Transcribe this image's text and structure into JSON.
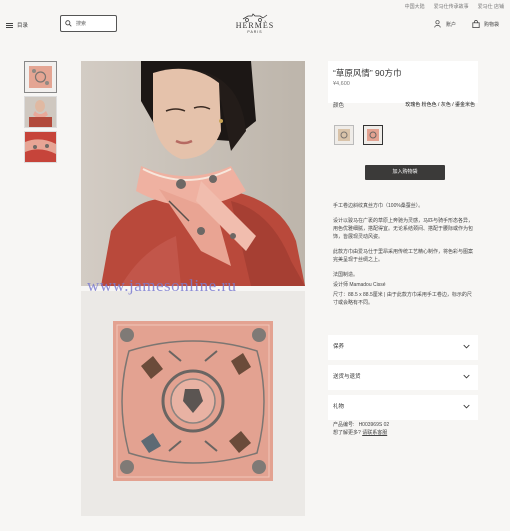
{
  "util_links": [
    "中国大陆",
    "爱马仕传承故事",
    "爱马仕 店铺"
  ],
  "menu_label": "目录",
  "search": {
    "placeholder": "搜索"
  },
  "brand": {
    "name": "HERMÈS",
    "city": "PARIS"
  },
  "account_label": "账户",
  "cart_label": "购物袋",
  "watermark": "www.jamesonline.ru",
  "product": {
    "title": "“草原风情” 90方巾",
    "price": "¥4,600",
    "color_label": "颜色",
    "color_value": "玫瑰色 粉色色 / 灰色 / 鎏金米色",
    "add_to_bag": "加入购物袋",
    "desc1": "手工卷边斜纹真丝方巾（100%桑蚕丝）。",
    "desc2": "设计以骏马在广袤的草原上奔驰为灵感，马匹与骑手形态各异，用色优雅细腻，搭配得宜。无论系结颈间、搭配于腰际或作为包饰，皆展现灵动风姿。",
    "desc3": "此款方巾由爱马仕于里昂采用传统工艺精心制作，将色彩与图案完美呈现于丝绸之上。",
    "desc4": "法国制造。",
    "designer": "设计师 Mamadou Cissé",
    "size": "尺寸：88.5 x 88.5厘米 | 由于此款方巾采用手工卷边，标示的尺寸或会略有不同。",
    "accordions": [
      "保养",
      "送货与退货",
      "礼物"
    ],
    "ref_label": "产品编号:",
    "ref_value": "H003969S 02",
    "help_text": "想了解更多?",
    "contact_link": "请联系客服"
  }
}
